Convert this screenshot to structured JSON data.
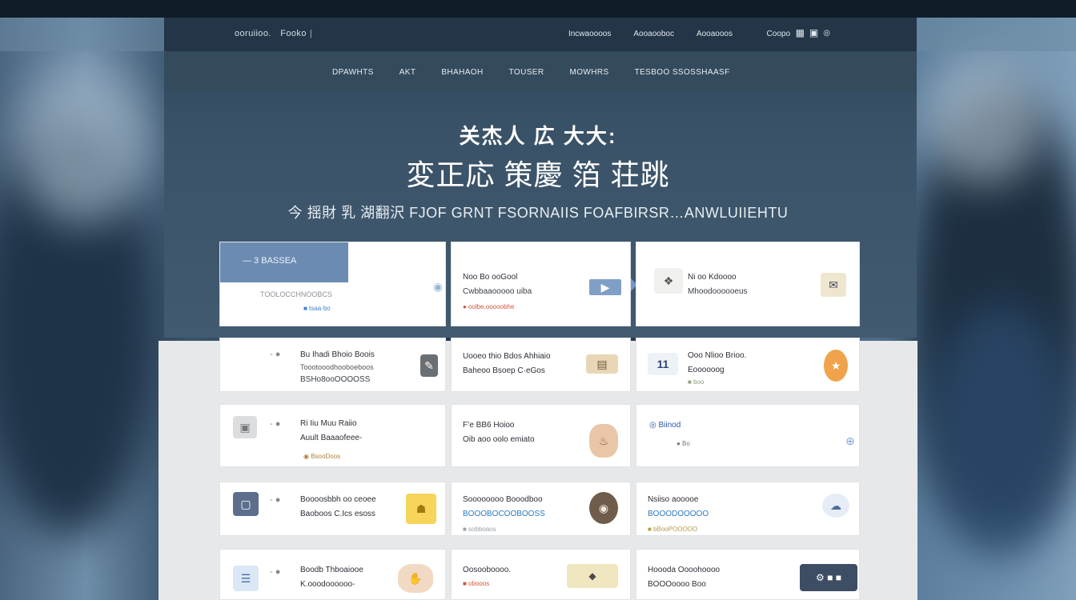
{
  "header": {
    "brand_a": "ooruiioo.",
    "brand_b": "Fooko",
    "nav": [
      "Incwaoooos",
      "Aooaooboc",
      "Aooaooos"
    ],
    "search_label": "Coopo",
    "icons": [
      "grid-icon",
      "bookmark-icon",
      "info-icon"
    ]
  },
  "navbar": {
    "items": [
      "DPAWHTS",
      "AKT",
      "BHAHAOH",
      "TOUSER",
      "MOWHRS",
      "TESBOO SSOSSHAASF"
    ]
  },
  "hero": {
    "line1": "关杰人 広 大大:",
    "line2": "変正応 策慶 箔 荘跳",
    "line3": "今 揺財  乳  湖翻沢  FJOF GRNT FSORNAIIS FOAFBIRSR…ANWLUIIEHTU"
  },
  "cards": [
    {
      "ribbon": "— 3 BASSEA",
      "t1": "",
      "t2": "",
      "t3": "TOOLOCCHNOOBCS",
      "tag": "■ tsaa·bo",
      "icon": "expand-icon"
    },
    {
      "ribbon": "",
      "t1": "Noo Bo ooGool",
      "t2": "Cwbbaaooooo uiba",
      "t3": "",
      "tag": "● oolbe,ooooobhe",
      "icon": "video-icon"
    },
    {
      "ribbon": "",
      "t1": "Ni  oo Kdoooo",
      "t2": "Mhoodoooooeus",
      "t3": "",
      "tag": "",
      "icon": "envelope-icon"
    },
    {
      "ribbon": "",
      "t1": "Bu Ihadi Bhoio Boois",
      "t2": "Toootooodhooboeboos",
      "t3": "BSHo8ooOOOOSS",
      "tag": "",
      "icon": "document-icon"
    },
    {
      "ribbon": "",
      "t1": "Uooeo thio Bdos Ahhiaio",
      "t2": "Baheoo Bsoep C·eGos",
      "t3": "",
      "tag": "",
      "icon": "ticket-icon"
    },
    {
      "ribbon": "",
      "t1": "Ooo  Nlioo Brioo.",
      "t2": "Eoooooog",
      "t3": "",
      "tag": "■ boo",
      "icon": "bell-icon"
    },
    {
      "ribbon": "",
      "t1": "Ri Iiu Muu Raiio",
      "t2": "Auult Baaaofeee-",
      "t3": "",
      "tag": "◉ BsooDoos",
      "icon": "image-icon"
    },
    {
      "ribbon": "",
      "t1": "F’e BB6 Hoioo",
      "t2": "Oib aoo oolo emiato",
      "t3": "",
      "tag": "",
      "icon": "jar-icon"
    },
    {
      "ribbon": "",
      "t1": "◎ Biinod",
      "t2": "",
      "t3": "",
      "tag": "● Bo",
      "icon": "plus-circle-icon"
    },
    {
      "ribbon": "",
      "t1": "Boooosbbh oo ceoee",
      "t2": "Baoboos C.Ics esoss",
      "t3": "",
      "tag": "",
      "icon": "bag-icon"
    },
    {
      "ribbon": "",
      "t1": "Soooooooo Booodboo",
      "t2": "BOOOBOCOOBOOSS",
      "t3": "",
      "tag": "■ sobboaos",
      "icon": "pot-icon"
    },
    {
      "ribbon": "",
      "t1": "Nsiiso aooooe",
      "t2": "BOOODOOOOO",
      "t3": "",
      "tag": "■ bBooPOOOOO",
      "icon": "cloud-icon"
    },
    {
      "ribbon": "",
      "t1": "Boodb Thboaiooe",
      "t2": "K.ooodoooooo-",
      "t3": "",
      "tag": "",
      "icon": "hand-icon"
    },
    {
      "ribbon": "",
      "t1": "Oosooboooo.",
      "t2": "",
      "t3": "",
      "tag": "■ obooos",
      "icon": "badge-icon"
    },
    {
      "ribbon": "",
      "t1": "Hoooda Oooohoooo",
      "t2": "BOOOoooo Boo",
      "t3": "",
      "tag": "",
      "icon": "tools-icon"
    }
  ]
}
